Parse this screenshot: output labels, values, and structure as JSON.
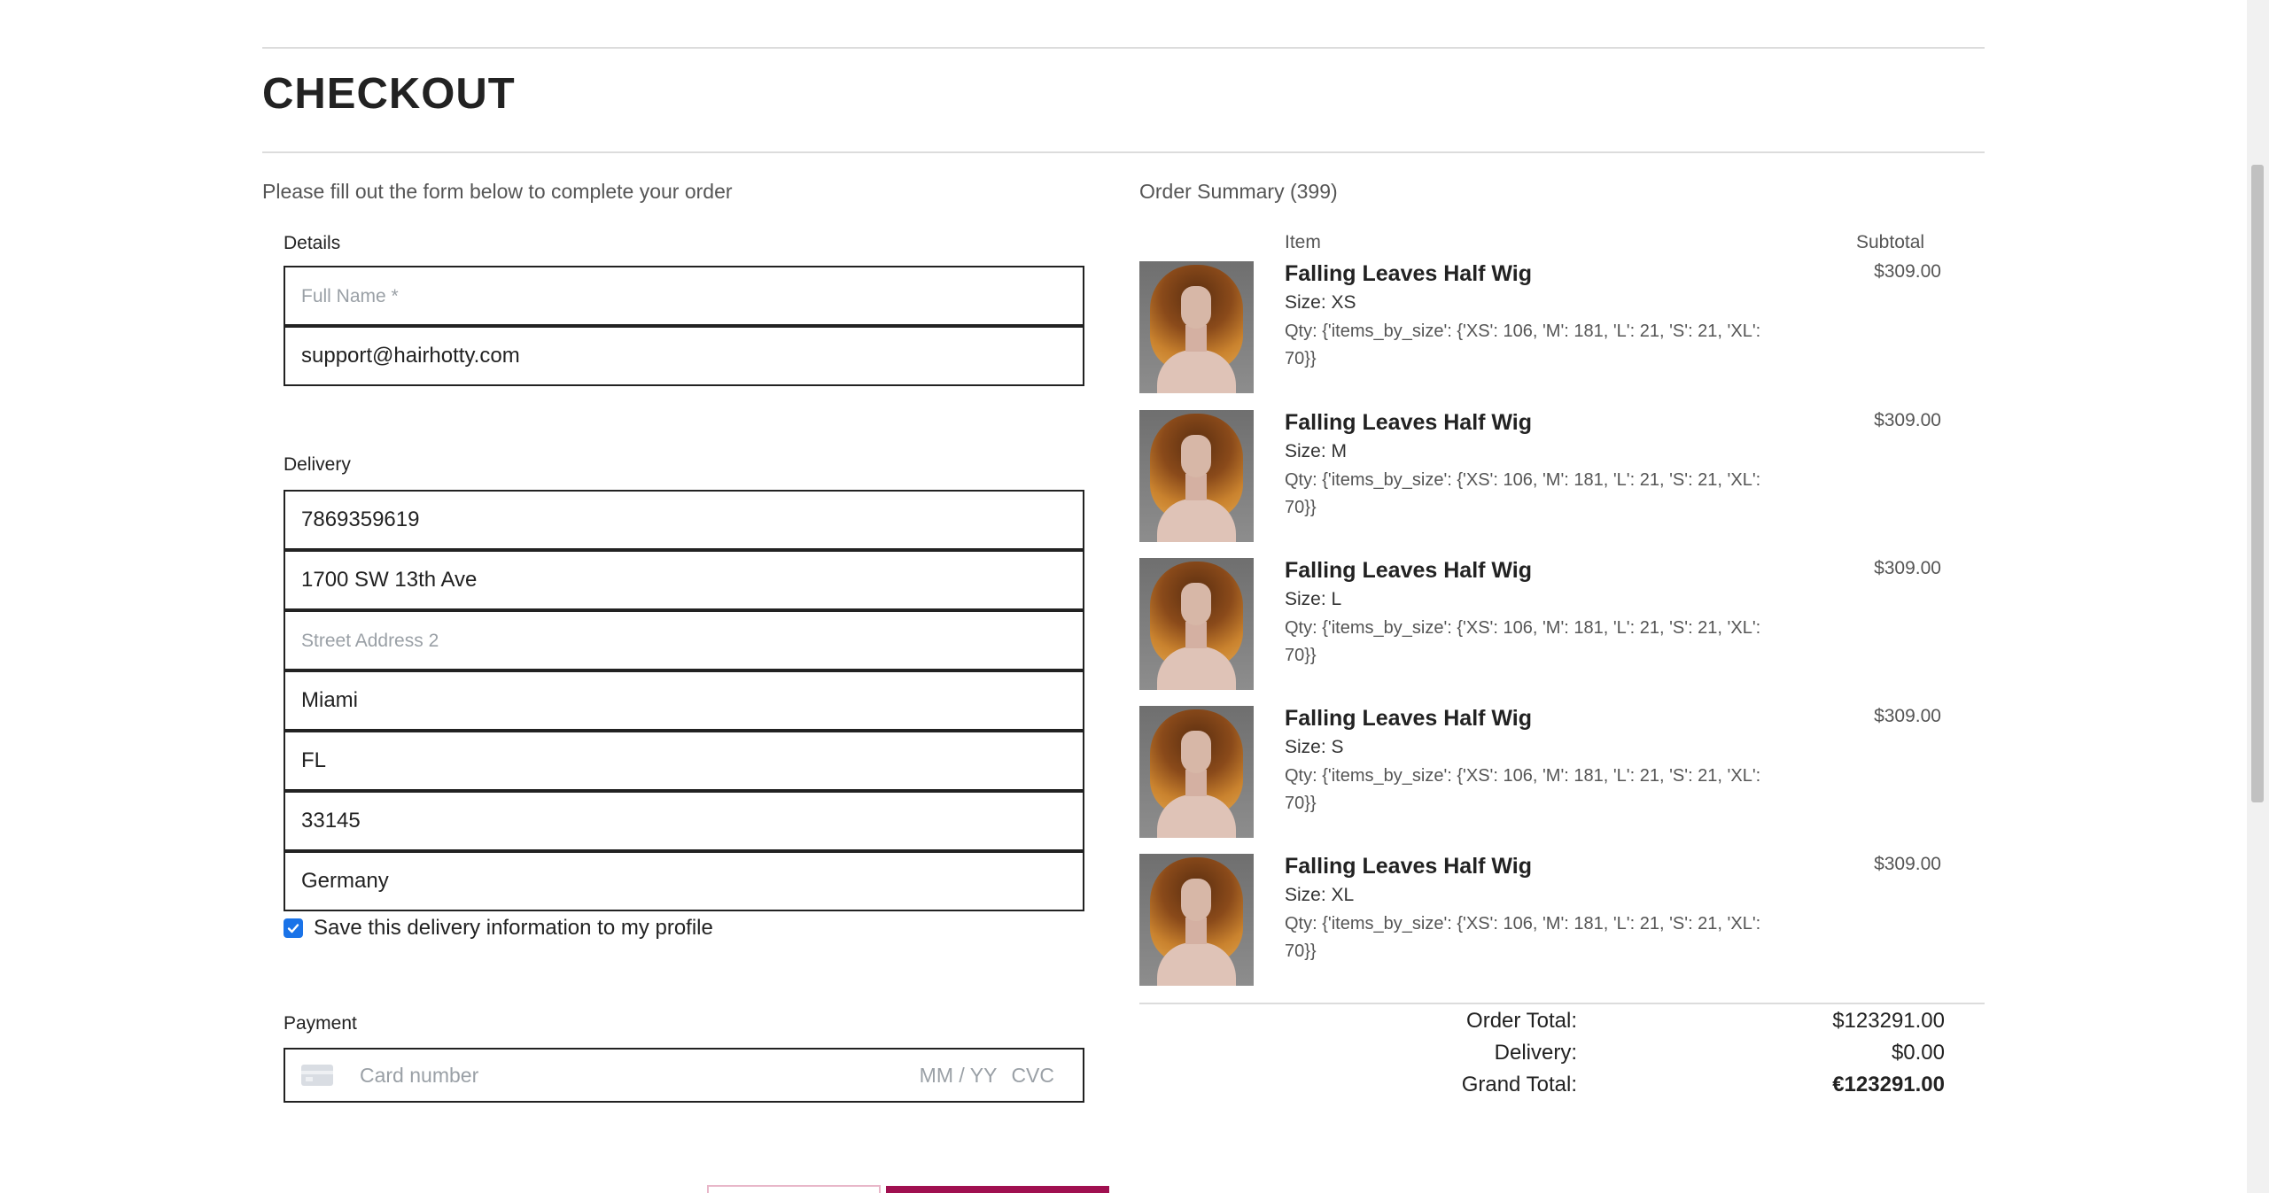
{
  "checkout": {
    "title": "CHECKOUT",
    "intro": "Please fill out the form below to complete your order"
  },
  "details": {
    "label": "Details",
    "full_name_placeholder": "Full Name *",
    "full_name_value": "",
    "email_value": "support@hairhotty.com"
  },
  "delivery": {
    "label": "Delivery",
    "phone": "7869359619",
    "street1": "1700 SW 13th Ave",
    "street2_placeholder": "Street Address 2",
    "street2": "",
    "city": "Miami",
    "state": "FL",
    "postcode": "33145",
    "country": "Germany",
    "save_label": "Save this delivery information to my profile",
    "save_checked": true
  },
  "payment": {
    "label": "Payment",
    "card_placeholder": "Card number",
    "exp_placeholder": "MM / YY",
    "cvc_placeholder": "CVC"
  },
  "summary": {
    "title": "Order Summary (399)",
    "col_item": "Item",
    "col_subtotal": "Subtotal",
    "items": [
      {
        "name": "Falling Leaves Half Wig",
        "size": "Size: XS",
        "qty": "Qty: {'items_by_size': {'XS': 106, 'M': 181, 'L': 21, 'S': 21, 'XL': 70}}",
        "price": "$309.00"
      },
      {
        "name": "Falling Leaves Half Wig",
        "size": "Size: M",
        "qty": "Qty: {'items_by_size': {'XS': 106, 'M': 181, 'L': 21, 'S': 21, 'XL': 70}}",
        "price": "$309.00"
      },
      {
        "name": "Falling Leaves Half Wig",
        "size": "Size: L",
        "qty": "Qty: {'items_by_size': {'XS': 106, 'M': 181, 'L': 21, 'S': 21, 'XL': 70}}",
        "price": "$309.00"
      },
      {
        "name": "Falling Leaves Half Wig",
        "size": "Size: S",
        "qty": "Qty: {'items_by_size': {'XS': 106, 'M': 181, 'L': 21, 'S': 21, 'XL': 70}}",
        "price": "$309.00"
      },
      {
        "name": "Falling Leaves Half Wig",
        "size": "Size: XL",
        "qty": "Qty: {'items_by_size': {'XS': 106, 'M': 181, 'L': 21, 'S': 21, 'XL': 70}}",
        "price": "$309.00"
      }
    ],
    "order_total_label": "Order Total:",
    "order_total_value": "$123291.00",
    "delivery_label": "Delivery:",
    "delivery_value": "$0.00",
    "grand_total_label": "Grand Total:",
    "grand_total_value": "€123291.00"
  },
  "colors": {
    "accent_checkbox": "#1a73e8",
    "submit_button": "#a01050",
    "secondary_button_border": "#e8b7c9"
  }
}
